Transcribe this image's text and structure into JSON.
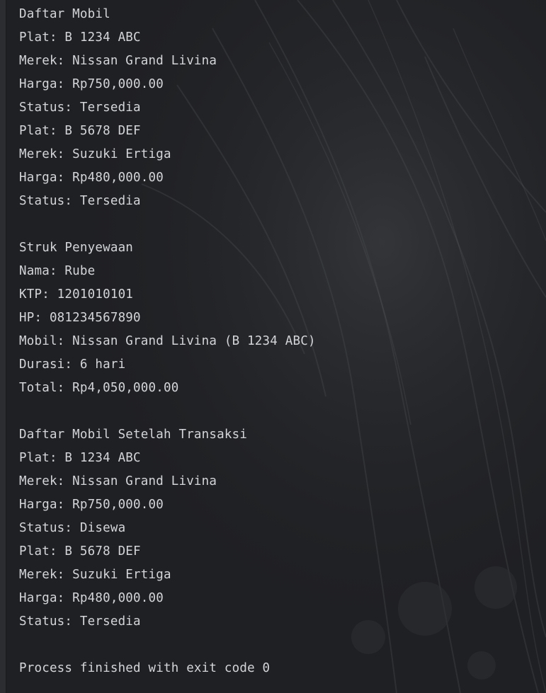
{
  "output_lines": [
    "Daftar Mobil",
    "Plat: B 1234 ABC",
    "Merek: Nissan Grand Livina",
    "Harga: Rp750,000.00",
    "Status: Tersedia",
    "Plat: B 5678 DEF",
    "Merek: Suzuki Ertiga",
    "Harga: Rp480,000.00",
    "Status: Tersedia",
    "",
    "Struk Penyewaan",
    "Nama: Rube",
    "KTP: 1201010101",
    "HP: 081234567890",
    "Mobil: Nissan Grand Livina (B 1234 ABC)",
    "Durasi: 6 hari",
    "Total: Rp4,050,000.00",
    "",
    "Daftar Mobil Setelah Transaksi",
    "Plat: B 1234 ABC",
    "Merek: Nissan Grand Livina",
    "Harga: Rp750,000.00",
    "Status: Disewa",
    "Plat: B 5678 DEF",
    "Merek: Suzuki Ertiga",
    "Harga: Rp480,000.00",
    "Status: Tersedia",
    "",
    "Process finished with exit code 0"
  ],
  "colors": {
    "background": "#1f2023",
    "text": "#d3d5d8"
  }
}
